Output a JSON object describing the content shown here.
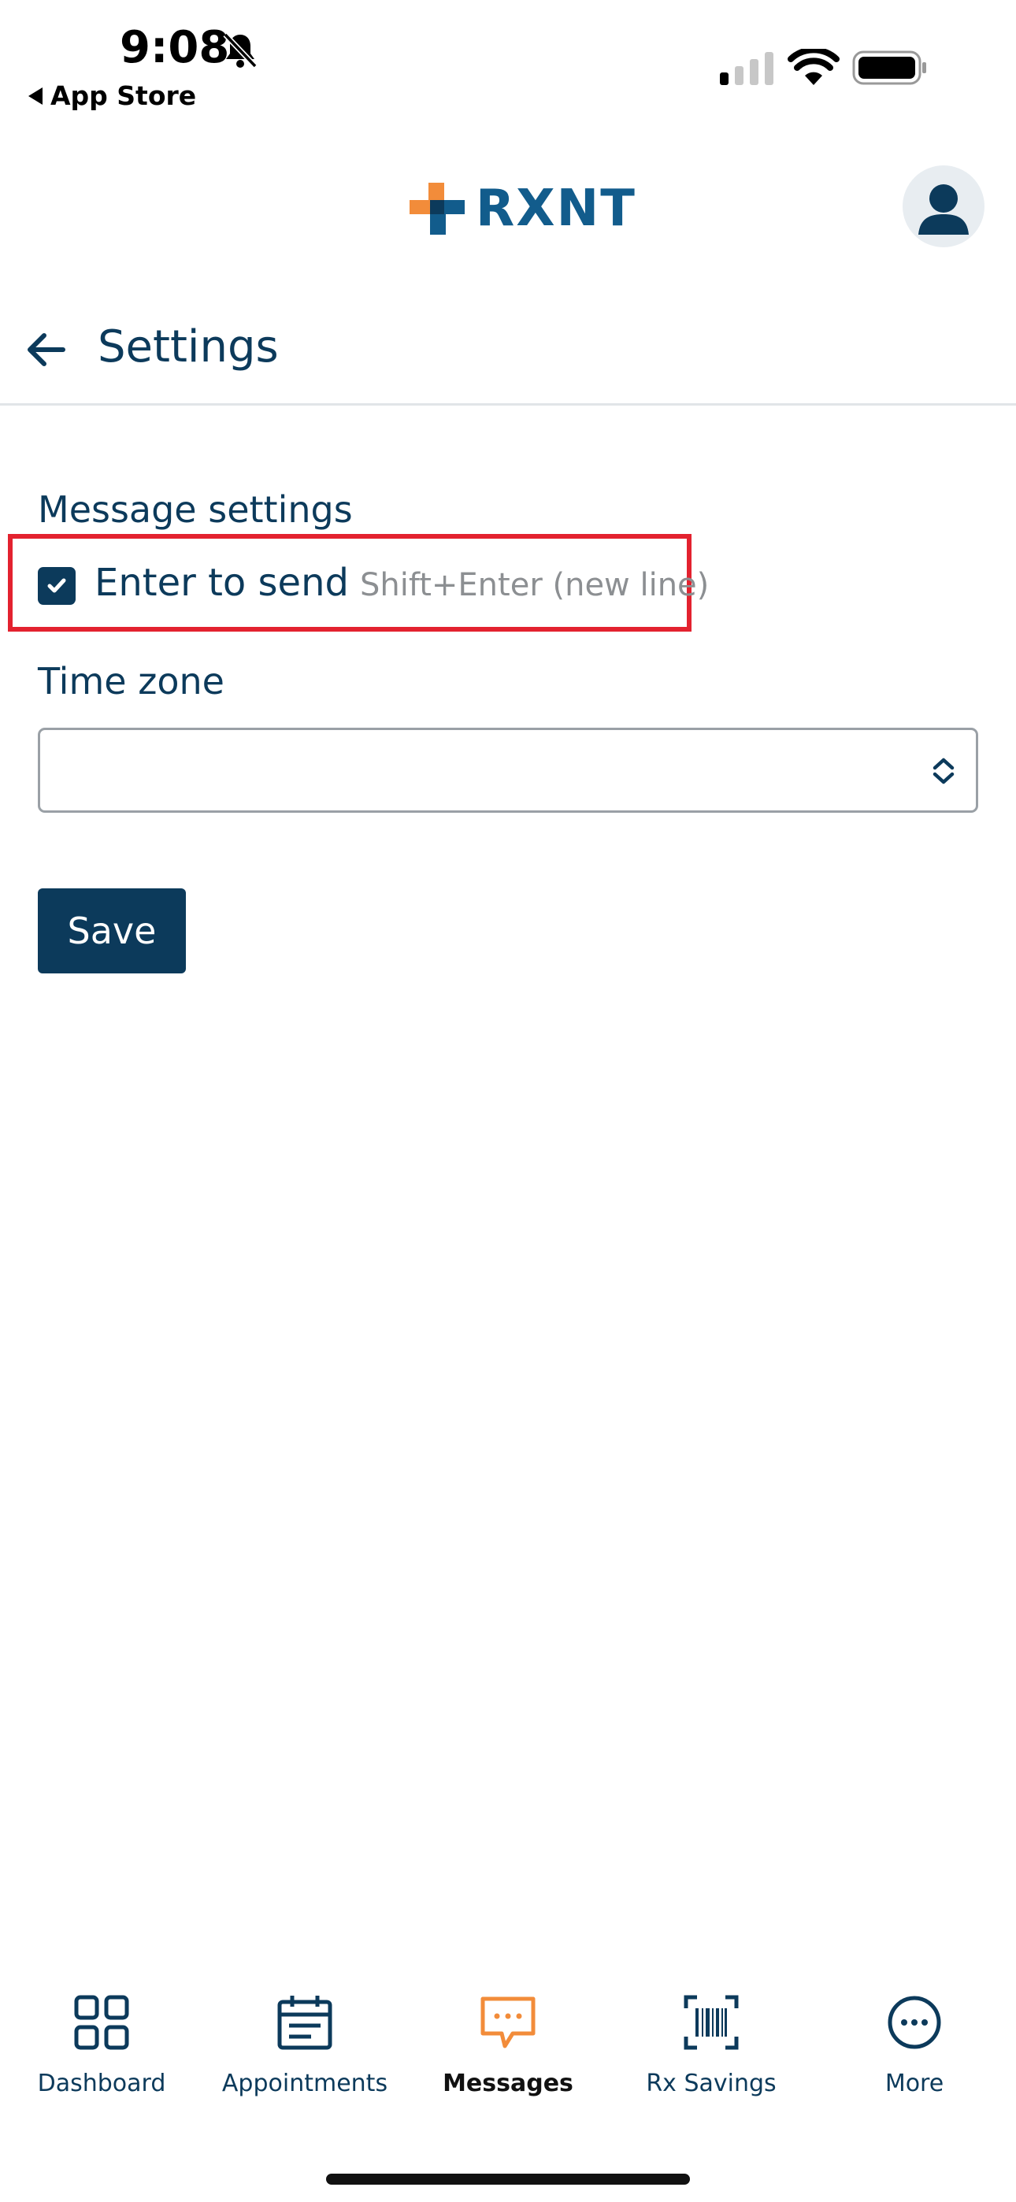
{
  "status_bar": {
    "time": "9:08",
    "back_app_label": "App Store",
    "icons": [
      "bell-slash-icon",
      "cellular-signal-icon",
      "wifi-icon",
      "battery-icon"
    ]
  },
  "header": {
    "logo_text": "RXNT",
    "logo_icon": "rxnt-cross-logo",
    "brand_colors": {
      "orange": "#f28c3a",
      "blue": "#125c8c",
      "navy": "#0c3a5b"
    }
  },
  "page": {
    "title": "Settings"
  },
  "settings": {
    "message_section_label": "Message settings",
    "enter_to_send": {
      "label": "Enter to send",
      "hint": "Shift+Enter (new line)",
      "checked": true
    },
    "time_zone_label": "Time zone",
    "time_zone_value": "",
    "save_label": "Save"
  },
  "highlight_color": "#e3222f",
  "bottom_nav": {
    "items": [
      {
        "label": "Dashboard",
        "icon": "dashboard-grid-icon",
        "active": false
      },
      {
        "label": "Appointments",
        "icon": "calendar-icon",
        "active": false
      },
      {
        "label": "Messages",
        "icon": "chat-bubble-icon",
        "active": true
      },
      {
        "label": "Rx Savings",
        "icon": "barcode-scan-icon",
        "active": false
      },
      {
        "label": "More",
        "icon": "more-dots-icon",
        "active": false
      }
    ],
    "active_color": "#f28c3a"
  }
}
